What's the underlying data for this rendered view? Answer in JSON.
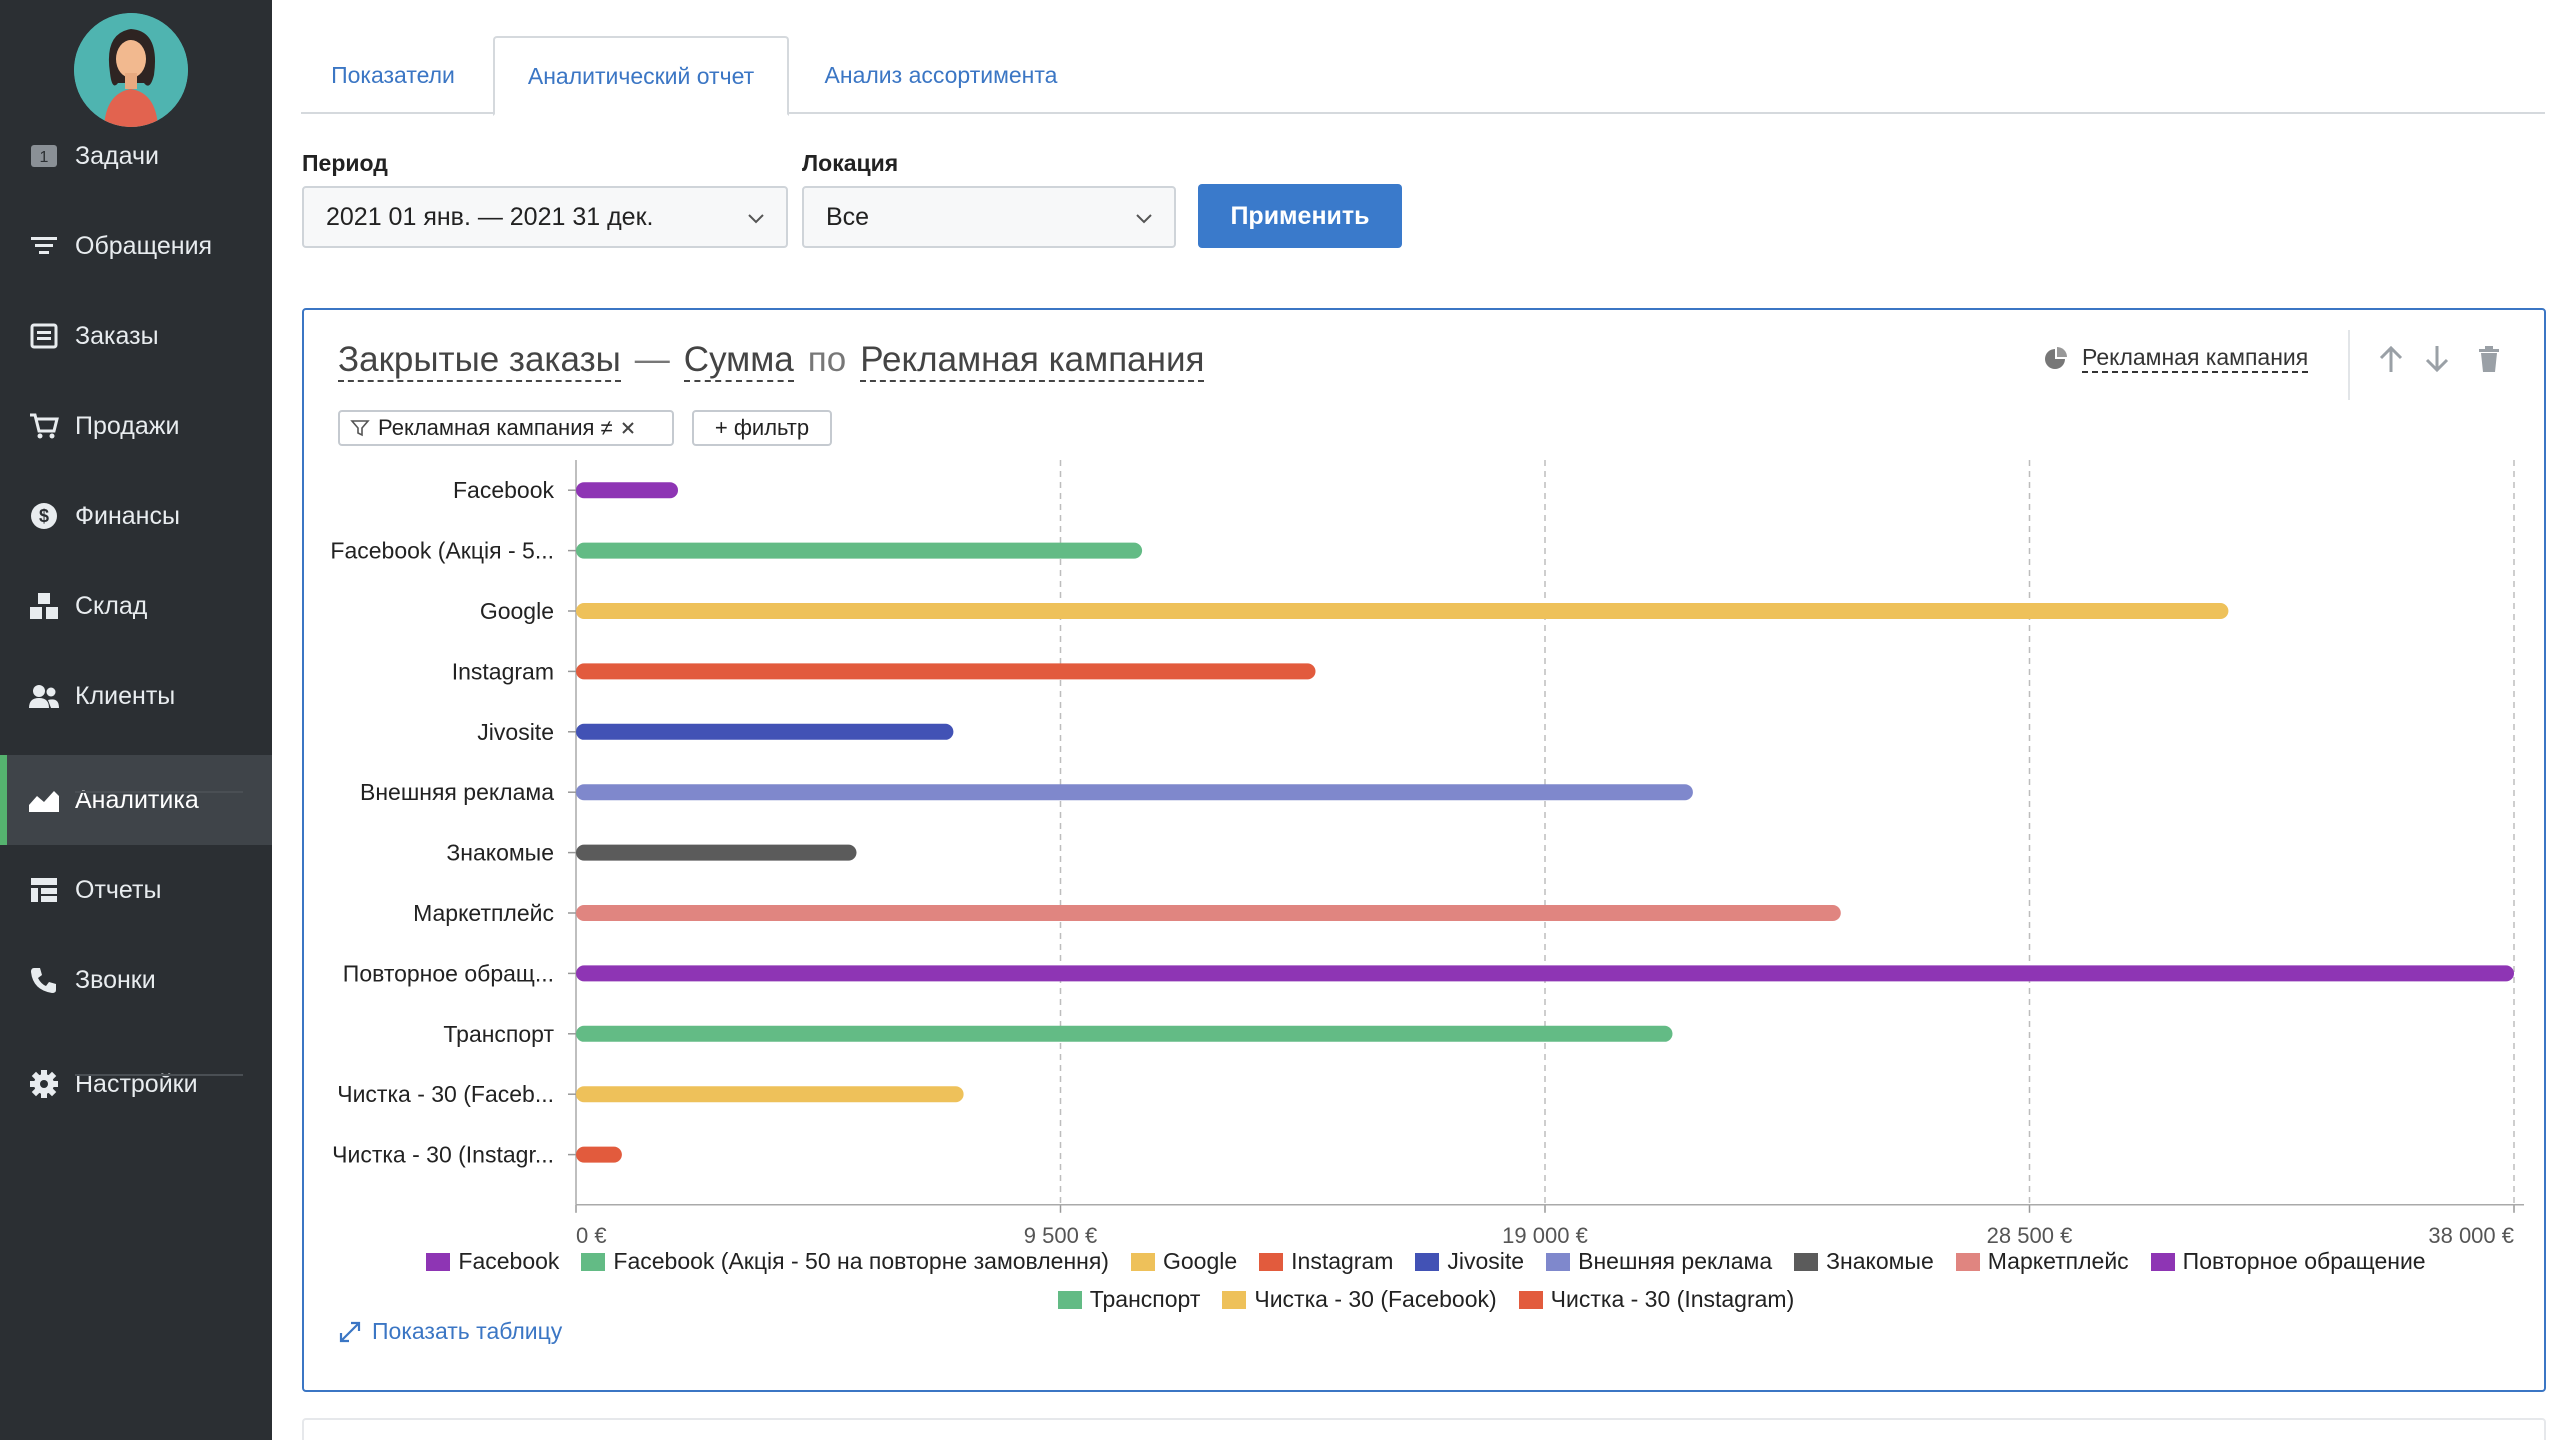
{
  "sidebar": {
    "items": [
      {
        "label": "Задачи",
        "icon": "task-badge-icon",
        "badge": "1"
      },
      {
        "label": "Обращения",
        "icon": "filter-icon"
      },
      {
        "label": "Заказы",
        "icon": "orders-icon"
      },
      {
        "label": "Продажи",
        "icon": "cart-icon"
      },
      {
        "label": "Финансы",
        "icon": "dollar-icon"
      },
      {
        "label": "Склад",
        "icon": "warehouse-icon"
      },
      {
        "label": "Клиенты",
        "icon": "users-icon"
      },
      {
        "label": "Аналитика",
        "icon": "chart-icon",
        "active": true
      },
      {
        "label": "Отчеты",
        "icon": "reports-icon"
      },
      {
        "label": "Звонки",
        "icon": "phone-icon"
      },
      {
        "label": "Настройки",
        "icon": "gear-icon"
      }
    ]
  },
  "tabs": [
    {
      "label": "Показатели"
    },
    {
      "label": "Аналитический отчет",
      "active": true
    },
    {
      "label": "Анализ ассортимента"
    }
  ],
  "filters": {
    "period_label": "Период",
    "period_value": "2021 01 янв. — 2021 31 дек.",
    "location_label": "Локация",
    "location_value": "Все",
    "apply_label": "Применить"
  },
  "widget": {
    "title_metric": "Закрытые заказы",
    "title_dash": "—",
    "title_agg": "Сумма",
    "title_by": "по",
    "title_dimension": "Рекламная кампания",
    "grouping_label": "Рекламная кампания",
    "filter_chip": "Рекламная кампания ≠",
    "add_filter": "+ фильтр",
    "show_table": "Показать таблицу"
  },
  "colors": {
    "accent": "#3a7acb",
    "sidebar_bg": "#2b2f33",
    "active_marker": "#55b36f"
  },
  "chart_data": {
    "type": "bar",
    "orientation": "horizontal",
    "categories": [
      "Facebook",
      "Facebook (Акція - 5...",
      "Google",
      "Instagram",
      "Jivosite",
      "Внешняя реклама",
      "Знакомые",
      "Маркетплейс",
      "Повторное обращ...",
      "Транспорт",
      "Чистка - 30 (Faceb...",
      "Чистка - 30 (Instagr..."
    ],
    "values": [
      2000,
      11100,
      32400,
      14500,
      7400,
      21900,
      5500,
      24800,
      38000,
      21500,
      7600,
      900
    ],
    "colors": [
      "#8e35b4",
      "#63bb85",
      "#eec15a",
      "#e25b3d",
      "#4252b5",
      "#7f88cc",
      "#5b5b5b",
      "#e08580",
      "#8e35b4",
      "#63bb85",
      "#eec15a",
      "#e25b3d"
    ],
    "xlim": [
      0,
      38000
    ],
    "xticks": [
      0,
      9500,
      19000,
      28500,
      38000
    ],
    "xtick_labels": [
      "0 €",
      "9 500 €",
      "19 000 €",
      "28 500 €",
      "38 000 €"
    ],
    "grid": "vertical dashed",
    "legend_position": "bottom",
    "legend": [
      {
        "label": "Facebook",
        "color": "#8e35b4"
      },
      {
        "label": "Facebook (Акція - 50 на повторне замовлення)",
        "color": "#63bb85"
      },
      {
        "label": "Google",
        "color": "#eec15a"
      },
      {
        "label": "Instagram",
        "color": "#e25b3d"
      },
      {
        "label": "Jivosite",
        "color": "#4252b5"
      },
      {
        "label": "Внешняя реклама",
        "color": "#7f88cc"
      },
      {
        "label": "Знакомые",
        "color": "#5b5b5b"
      },
      {
        "label": "Маркетплейс",
        "color": "#e08580"
      },
      {
        "label": "Повторное обращение",
        "color": "#8e35b4"
      },
      {
        "label": "Транспорт",
        "color": "#63bb85"
      },
      {
        "label": "Чистка - 30 (Facebook)",
        "color": "#eec15a"
      },
      {
        "label": "Чистка - 30 (Instagram)",
        "color": "#e25b3d"
      }
    ]
  }
}
